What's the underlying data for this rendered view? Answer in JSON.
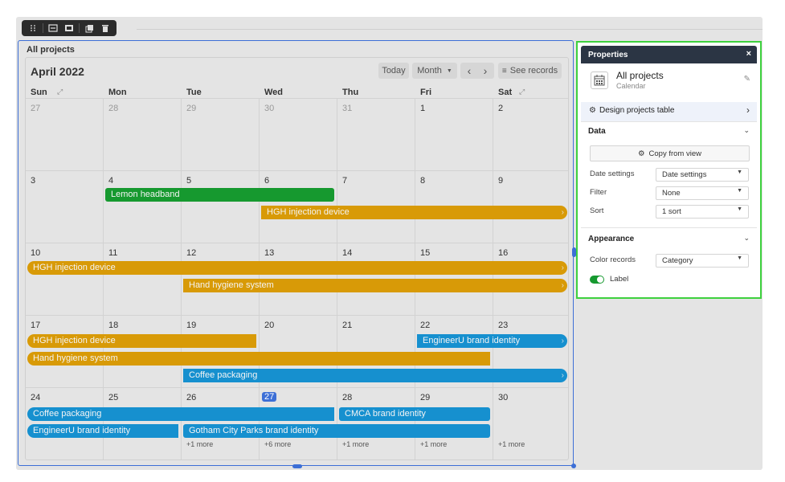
{
  "toolbar": {
    "icons": [
      "drag-handle-icon",
      "fit-width-icon",
      "full-width-icon",
      "duplicate-icon",
      "trash-icon"
    ]
  },
  "block": {
    "title": "All projects"
  },
  "calendar": {
    "month_label": "April 2022",
    "today_label": "Today",
    "view_label": "Month",
    "prev_label": "‹",
    "next_label": "›",
    "see_records_label": "See records",
    "days_of_week": [
      "Sun",
      "Mon",
      "Tue",
      "Wed",
      "Thu",
      "Fri",
      "Sat"
    ],
    "weeks": [
      [
        {
          "d": "27",
          "muted": true
        },
        {
          "d": "28",
          "muted": true
        },
        {
          "d": "29",
          "muted": true
        },
        {
          "d": "30",
          "muted": true
        },
        {
          "d": "31",
          "muted": true
        },
        {
          "d": "1"
        },
        {
          "d": "2"
        }
      ],
      [
        {
          "d": "3"
        },
        {
          "d": "4"
        },
        {
          "d": "5"
        },
        {
          "d": "6"
        },
        {
          "d": "7"
        },
        {
          "d": "8"
        },
        {
          "d": "9"
        }
      ],
      [
        {
          "d": "10"
        },
        {
          "d": "11"
        },
        {
          "d": "12"
        },
        {
          "d": "13"
        },
        {
          "d": "14"
        },
        {
          "d": "15"
        },
        {
          "d": "16"
        }
      ],
      [
        {
          "d": "17"
        },
        {
          "d": "18"
        },
        {
          "d": "19"
        },
        {
          "d": "20"
        },
        {
          "d": "21"
        },
        {
          "d": "22"
        },
        {
          "d": "23"
        }
      ],
      [
        {
          "d": "24"
        },
        {
          "d": "25"
        },
        {
          "d": "26"
        },
        {
          "d": "27",
          "today": true
        },
        {
          "d": "28"
        },
        {
          "d": "29"
        },
        {
          "d": "30"
        }
      ]
    ],
    "events": [
      {
        "title": "Lemon headband",
        "color": "green"
      },
      {
        "title": "HGH injection device",
        "color": "orange"
      },
      {
        "title": "HGH injection device",
        "color": "orange"
      },
      {
        "title": "Hand hygiene system",
        "color": "orange"
      },
      {
        "title": "HGH injection device",
        "color": "orange"
      },
      {
        "title": "EngineerU brand identity",
        "color": "blue"
      },
      {
        "title": "Hand hygiene system",
        "color": "orange"
      },
      {
        "title": "Coffee packaging",
        "color": "blue"
      },
      {
        "title": "Coffee packaging",
        "color": "blue"
      },
      {
        "title": "CMCA brand identity",
        "color": "blue"
      },
      {
        "title": "EngineerU brand identity",
        "color": "blue"
      },
      {
        "title": "Gotham City Parks brand identity",
        "color": "blue"
      }
    ],
    "more_labels": [
      "+1 more",
      "+6 more",
      "+1 more",
      "+1 more",
      "+1 more"
    ]
  },
  "properties": {
    "title": "Properties",
    "close_label": "×",
    "element_name": "All projects",
    "element_type": "Calendar",
    "design_table_label": "Design projects table",
    "data_section": "Data",
    "copy_from_view_label": "Copy from view",
    "date_settings_label": "Date settings",
    "date_settings_value": "Date settings",
    "filter_label": "Filter",
    "filter_value": "None",
    "sort_label": "Sort",
    "sort_value": "1 sort",
    "appearance_section": "Appearance",
    "color_records_label": "Color records",
    "color_records_value": "Category",
    "label_toggle_label": "Label",
    "label_toggle_on": true
  },
  "colors": {
    "green": "#16992f",
    "orange": "#d89a07",
    "blue": "#1690cf",
    "selection": "#3d6fd6",
    "panel_border": "#3ed13e",
    "panel_header": "#2b3544"
  }
}
